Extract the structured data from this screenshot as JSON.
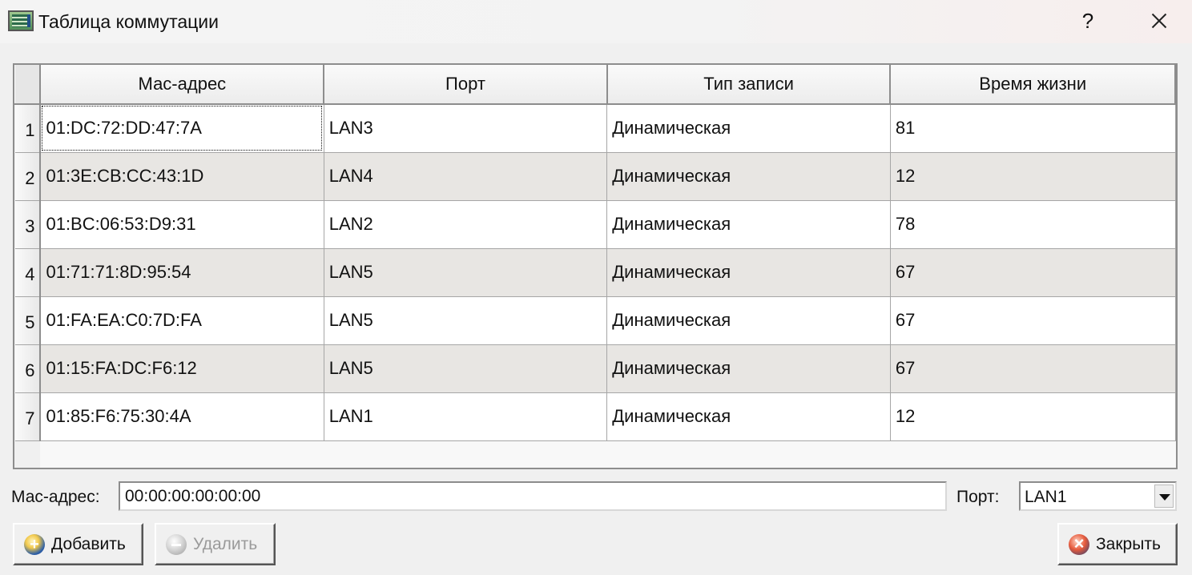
{
  "window": {
    "title": "Таблица коммутации",
    "help_glyph": "?"
  },
  "table": {
    "headers": [
      "Мас-адрес",
      "Порт",
      "Тип записи",
      "Время жизни"
    ],
    "rows": [
      {
        "num": "1",
        "mac": "01:DC:72:DD:47:7A",
        "port": "LAN3",
        "type": "Динамическая",
        "ttl": "81"
      },
      {
        "num": "2",
        "mac": "01:3E:CB:CC:43:1D",
        "port": "LAN4",
        "type": "Динамическая",
        "ttl": "12"
      },
      {
        "num": "3",
        "mac": "01:BC:06:53:D9:31",
        "port": "LAN2",
        "type": "Динамическая",
        "ttl": "78"
      },
      {
        "num": "4",
        "mac": "01:71:71:8D:95:54",
        "port": "LAN5",
        "type": "Динамическая",
        "ttl": "67"
      },
      {
        "num": "5",
        "mac": "01:FA:EA:C0:7D:FA",
        "port": "LAN5",
        "type": "Динамическая",
        "ttl": "67"
      },
      {
        "num": "6",
        "mac": "01:15:FA:DC:F6:12",
        "port": "LAN5",
        "type": "Динамическая",
        "ttl": "67"
      },
      {
        "num": "7",
        "mac": "01:85:F6:75:30:4A",
        "port": "LAN1",
        "type": "Динамическая",
        "ttl": "12"
      }
    ]
  },
  "form": {
    "mac_label": "Мас-адрес:",
    "mac_value": "00:00:00:00:00:00",
    "port_label": "Порт:",
    "port_value": "LAN1"
  },
  "buttons": {
    "add": "Добавить",
    "delete": "Удалить",
    "close": "Закрыть"
  }
}
